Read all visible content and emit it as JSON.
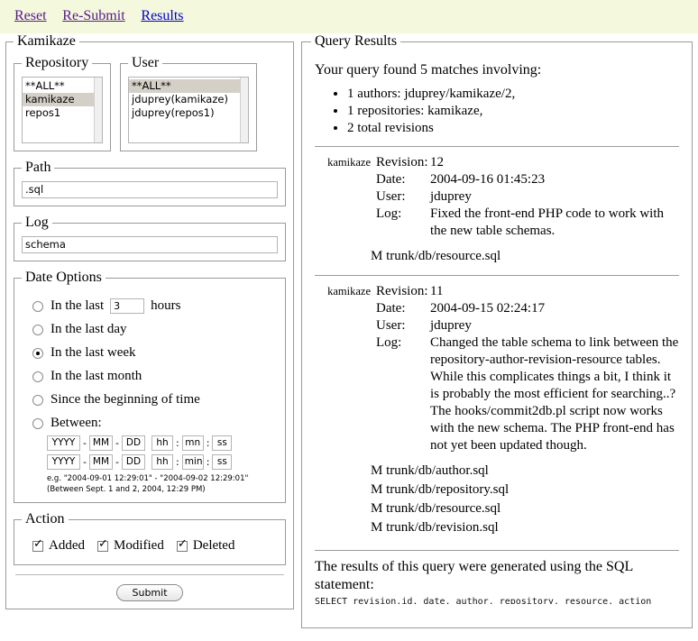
{
  "nav": {
    "links": [
      {
        "label": "Reset",
        "state": "visited"
      },
      {
        "label": "Re-Submit",
        "state": "visited"
      },
      {
        "label": "Results",
        "state": "unvisited"
      }
    ]
  },
  "form": {
    "legend": "Kamikaze",
    "repository": {
      "legend": "Repository",
      "options": [
        "**ALL**",
        "kamikaze",
        "repos1"
      ],
      "selected": "kamikaze"
    },
    "user": {
      "legend": "User",
      "options": [
        "**ALL**",
        "jduprey(kamikaze)",
        "jduprey(repos1)"
      ],
      "selected": "**ALL**"
    },
    "path": {
      "legend": "Path",
      "value": ".sql"
    },
    "log": {
      "legend": "Log",
      "value": "schema"
    },
    "date_options": {
      "legend": "Date Options",
      "selected": "In the last week",
      "options": [
        "In the last",
        "In the last day",
        "In the last week",
        "In the last month",
        "Since the beginning of time",
        "Between:"
      ],
      "hours_value": "3",
      "hours_suffix": "hours",
      "date_fields": {
        "year": "YYYY",
        "month": "MM",
        "day": "DD",
        "hour": "hh",
        "minute": "mn",
        "minute2": "min",
        "second": "ss",
        "dash": "-",
        "colon": ":"
      },
      "example_line1": "e.g. \"2004-09-01 12:29:01\" - \"2004-09-02 12:29:01\"",
      "example_line2": "(Between Sept. 1 and 2, 2004, 12:29 PM)"
    },
    "action": {
      "legend": "Action",
      "items": [
        {
          "label": "Added",
          "checked": true
        },
        {
          "label": "Modified",
          "checked": true
        },
        {
          "label": "Deleted",
          "checked": true
        }
      ]
    },
    "submit_label": "Submit"
  },
  "results": {
    "legend": "Query Results",
    "lead": "Your query found 5 matches involving:",
    "matches": [
      "1 authors: jduprey/kamikaze/2,",
      "1 repositories: kamikaze,",
      "2 total revisions"
    ],
    "labels": {
      "revision": "Revision:",
      "date": "Date:",
      "user": "User:",
      "log": "Log:"
    },
    "revisions": [
      {
        "repo": "kamikaze",
        "revision": "12",
        "date": "2004-09-16 01:45:23",
        "user": "jduprey",
        "log": "Fixed the front-end PHP code to work with the new table schemas.",
        "files": [
          "M trunk/db/resource.sql"
        ]
      },
      {
        "repo": "kamikaze",
        "revision": "11",
        "date": "2004-09-15 02:24:17",
        "user": "jduprey",
        "log": "Changed the table schema to link between the repository-author-revision-resource tables. While this complicates things a bit, I think it is probably the most efficient for searching..? The hooks/commit2db.pl script now works with the new schema. The PHP front-end has not yet been updated though.",
        "files": [
          "M trunk/db/author.sql",
          "M trunk/db/repository.sql",
          "M trunk/db/resource.sql",
          "M trunk/db/revision.sql"
        ]
      }
    ],
    "sql_intro": "The results of this query were generated using the SQL statement:"
  },
  "colors": {
    "nav_band": "#f4f8dc",
    "link_visited": "#551a8b",
    "link_unvisited": "#0000cc",
    "selection": "#d4d0c8",
    "border": "#9a9a9a"
  }
}
